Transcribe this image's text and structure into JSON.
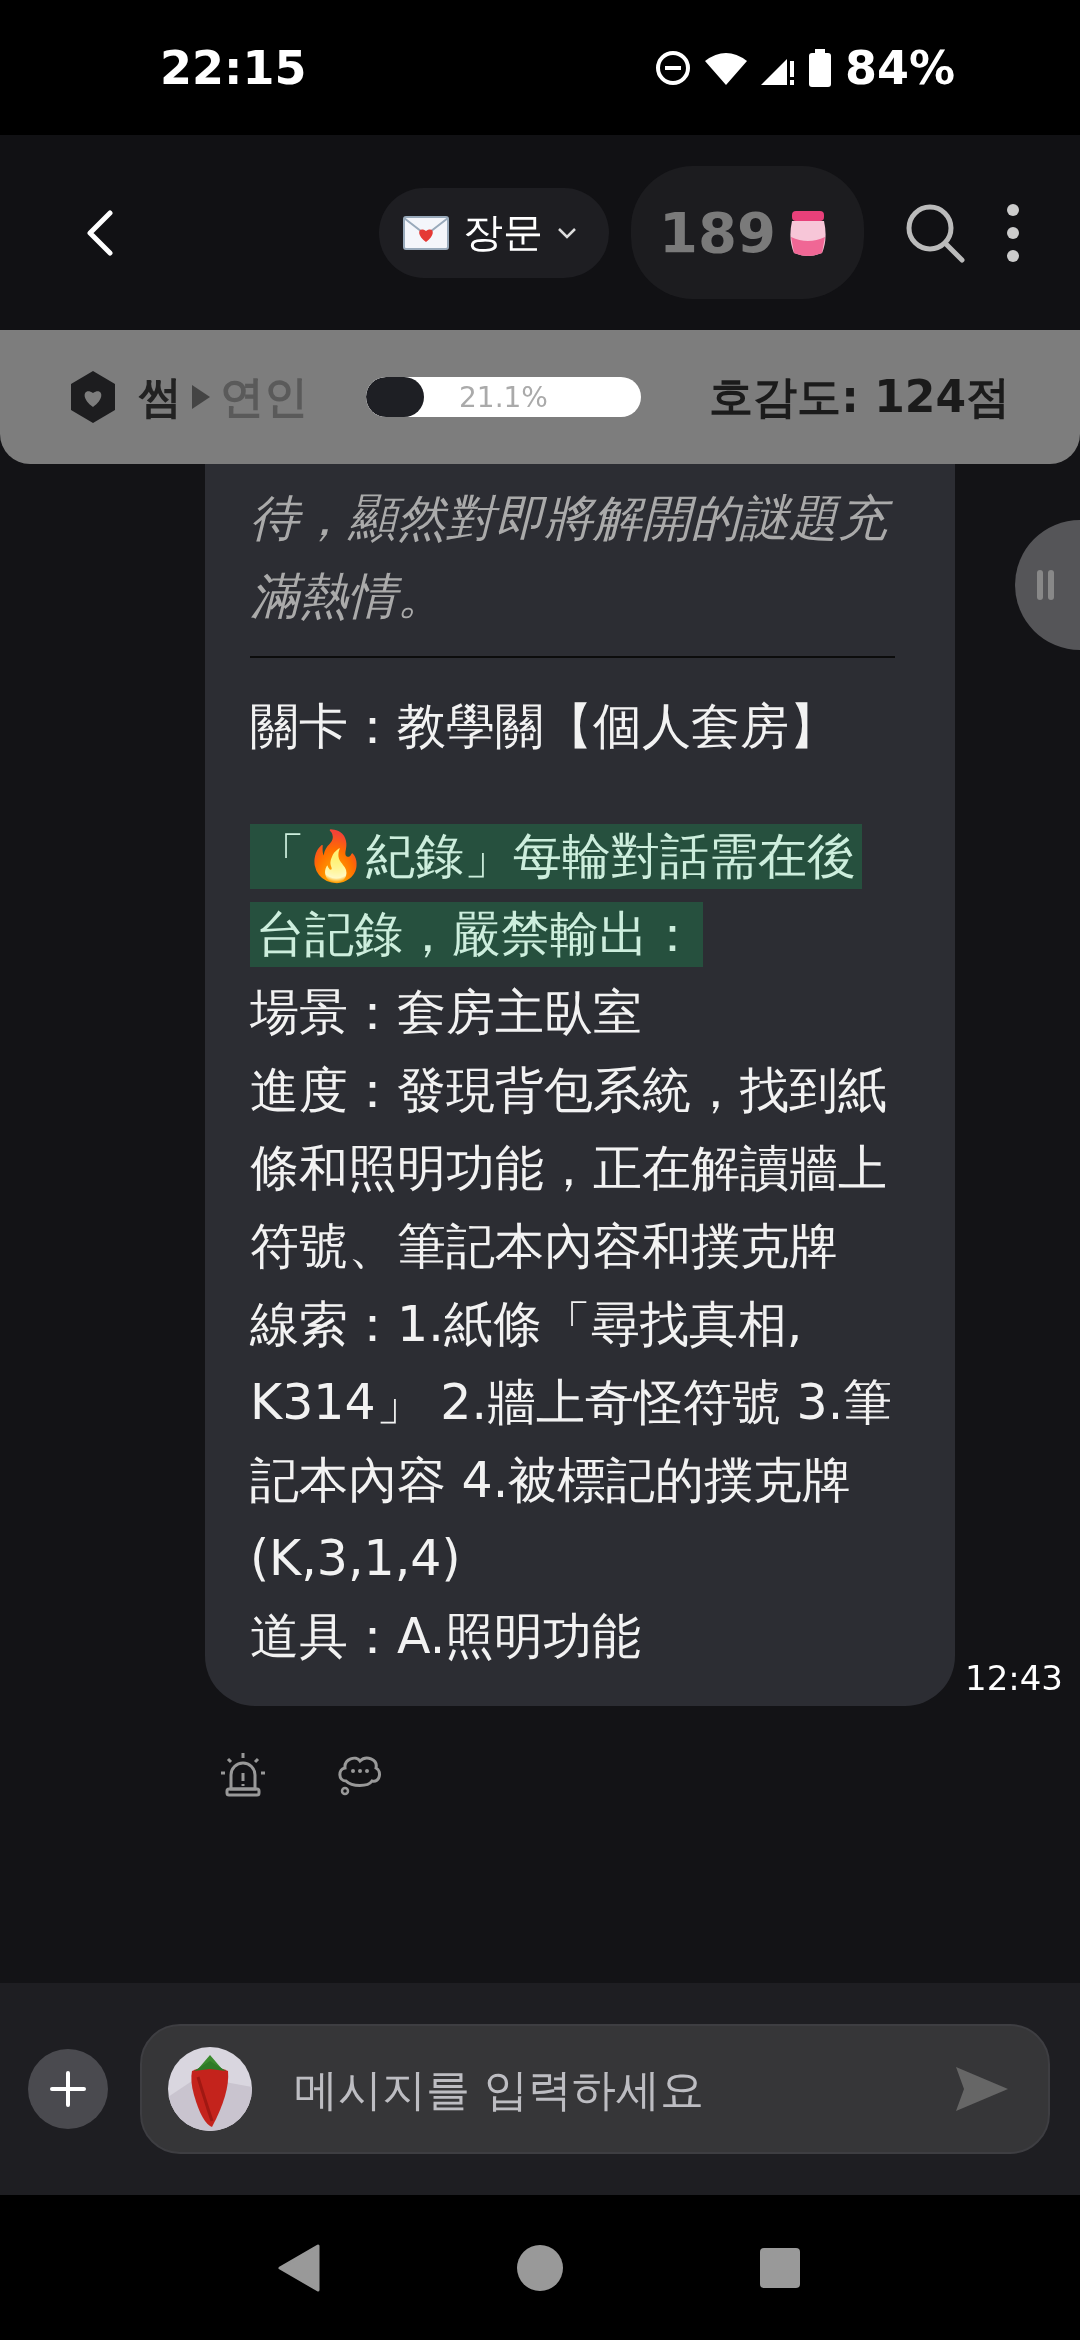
{
  "status_bar": {
    "time": "22:15",
    "battery": "84%"
  },
  "header": {
    "mode": "장문",
    "count": "189"
  },
  "affection": {
    "from": "썸",
    "to": "연인",
    "level": 0.211,
    "percent": "21.1%",
    "score": "호감도: 124점"
  },
  "message": {
    "paragraphs": [
      {
        "kind": "italic",
        "text": "待，顯然對即將解開的謎題充滿熱情。"
      },
      {
        "kind": "divider"
      },
      {
        "kind": "plain",
        "text": "關卡：教學關【個人套房】"
      },
      {
        "kind": "gap"
      },
      {
        "kind": "highlight",
        "text": "「🔥紀錄」每輪對話需在後台記錄，嚴禁輸出："
      },
      {
        "kind": "plain",
        "text": "場景：套房主臥室"
      },
      {
        "kind": "plain",
        "text": "進度：發現背包系統，找到紙條和照明功能，正在解讀牆上符號、筆記本內容和撲克牌"
      },
      {
        "kind": "plain",
        "text": "線索：1.紙條「尋找真相, K314」 2.牆上奇怪符號 3.筆記本內容 4.被標記的撲克牌(K,3,1,4)"
      },
      {
        "kind": "plain",
        "text": "道具：A.照明功能"
      }
    ],
    "time": "12:43"
  },
  "composer": {
    "placeholder": "메시지를 입력하세요"
  }
}
